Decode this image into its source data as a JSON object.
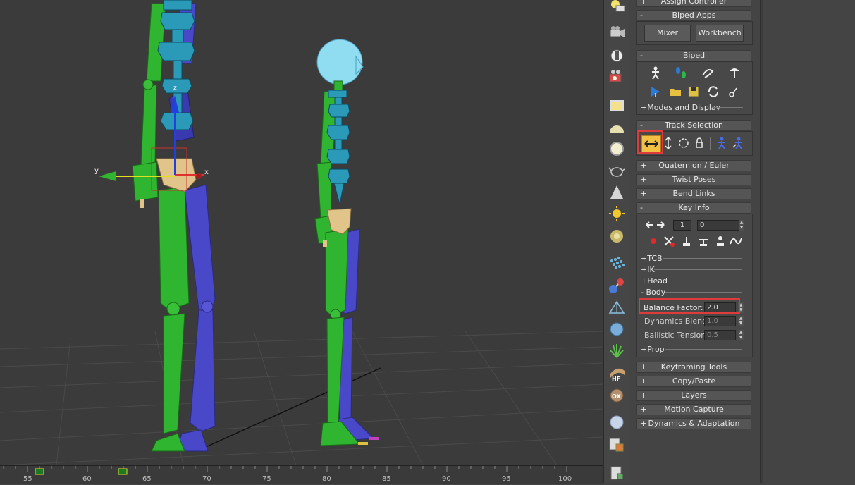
{
  "timeline": {
    "ticks": [
      "55",
      "60",
      "65",
      "70",
      "75",
      "80",
      "85",
      "90",
      "95",
      "100"
    ]
  },
  "viewport": {
    "gizmo_x": "x",
    "gizmo_y": "y",
    "gizmo_z": "z"
  },
  "icon_column": [
    "lightbulb-keyboard-icon",
    "camera-icon",
    "plug-icon",
    "camera-color-icon",
    "yellow-box-icon",
    "dome-icon",
    "sphere-outline-icon",
    "teapot-icon",
    "cone-icon",
    "sun-icon",
    "torus-icon",
    "dots-grid-icon",
    "atom-icon",
    "pyramid-icon",
    "geosphere-icon",
    "grass-icon",
    "hf-icon",
    "ox-icon",
    "sphere-icon",
    "boxes-icon",
    "clipboard-icon"
  ],
  "panel": {
    "assign_controller": "Assign Controller",
    "biped_apps": {
      "title": "Biped Apps",
      "mixer": "Mixer",
      "workbench": "Workbench",
      "pm": "-"
    },
    "biped": {
      "title": "Biped",
      "pm": "-",
      "modes_display": "+Modes and Display"
    },
    "track_selection": {
      "title": "Track Selection",
      "pm": "-"
    },
    "quaternion": {
      "title": "Quaternion / Euler",
      "pm": "+"
    },
    "twist_poses": {
      "title": "Twist Poses",
      "pm": "+"
    },
    "bend_links": {
      "title": "Bend Links",
      "pm": "+"
    },
    "key_info": {
      "title": "Key Info",
      "pm": "-",
      "key_number": "1",
      "key_time": "0",
      "tcb": "+TCB",
      "ik": "+IK",
      "head": "+Head",
      "body": "- Body",
      "balance_factor_label": "Balance Factor:",
      "balance_factor_value": "2.0",
      "dynamics_blend_label": "Dynamics Blend:",
      "dynamics_blend_value": "1.0",
      "ballistic_tension_label": "Ballistic Tension:",
      "ballistic_tension_value": "0.5",
      "prop": "+Prop"
    },
    "keyframing_tools": {
      "title": "Keyframing Tools",
      "pm": "+"
    },
    "copy_paste": {
      "title": "Copy/Paste",
      "pm": "+"
    },
    "layers": {
      "title": "Layers",
      "pm": "+"
    },
    "motion_capture": {
      "title": "Motion Capture",
      "pm": "+"
    },
    "dynamics_adaptation": {
      "title": "Dynamics & Adaptation",
      "pm": "+"
    }
  },
  "colors": {
    "highlight": "#e03a3a",
    "biped_green": "#2fb52f",
    "biped_blue": "#4848c8",
    "spine_cyan": "#2a9ab8",
    "pelvis": "#e0c48a"
  }
}
